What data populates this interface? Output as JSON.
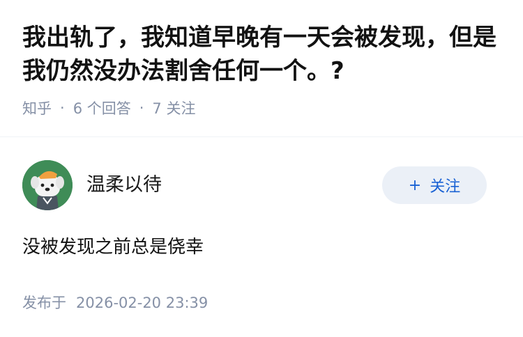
{
  "question": {
    "title": "我出轨了，我知道早晚有一天会被发现，但是我仍然没办法割舍任何一个。?",
    "source": "知乎",
    "answers_count": "6 个回答",
    "followers_count": "7 关注"
  },
  "answer": {
    "author": {
      "name": "温柔以待",
      "avatar_icon": "cartoon-dog-avatar-icon"
    },
    "follow_button": {
      "label": "关注",
      "icon": "plus-icon"
    },
    "content": "没被发现之前总是侥幸",
    "published_label": "发布于",
    "published_time": "2026-02-20 23:39"
  },
  "colors": {
    "meta_gray": "#8590a6",
    "follow_blue": "#1a62d4",
    "follow_bg": "#ebf0f7",
    "avatar_green": "#3f8c57"
  }
}
